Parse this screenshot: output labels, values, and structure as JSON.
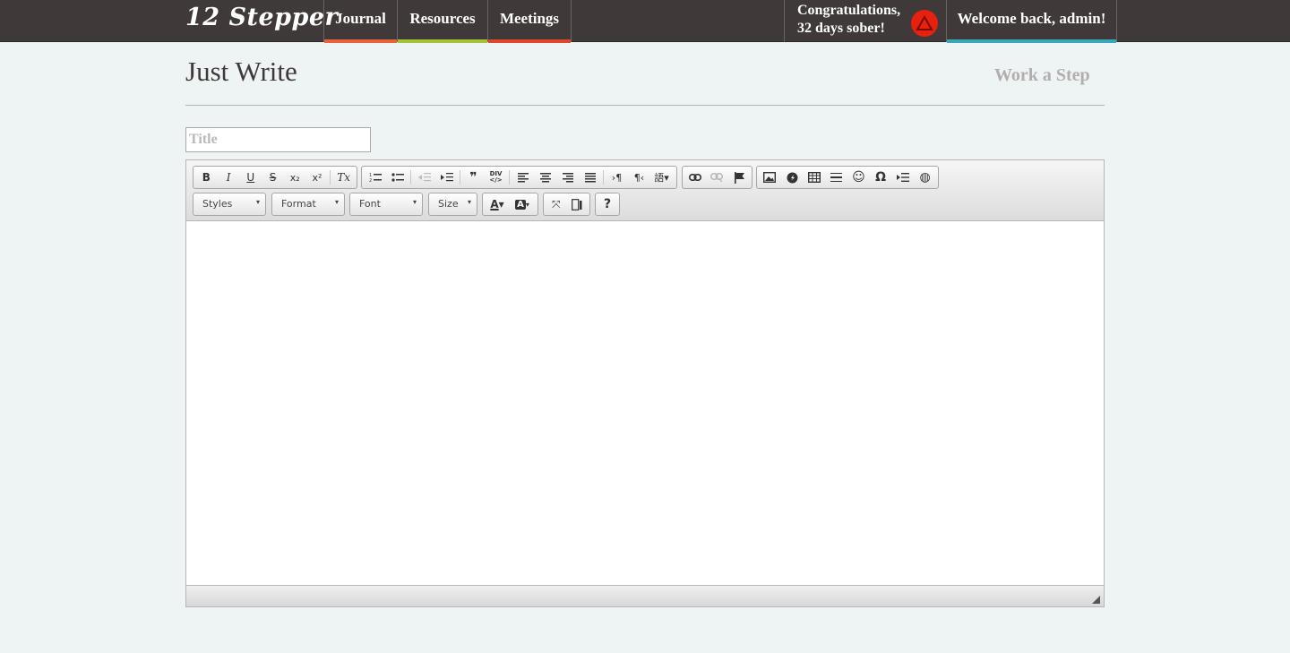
{
  "app": {
    "logo": "12 Stepper"
  },
  "nav": [
    {
      "label": "Journal",
      "color": "#e8623a"
    },
    {
      "label": "Resources",
      "color": "#a3c43a"
    },
    {
      "label": "Meetings",
      "color": "#e0452e"
    }
  ],
  "status": {
    "congrats_line1": "Congratulations,",
    "congrats_line2": "32 days sober!",
    "badge_icon": "recovery-triangle-icon"
  },
  "user": {
    "welcome": "Welcome back, admin!"
  },
  "page": {
    "title": "Just Write",
    "work_step_link": "Work a Step"
  },
  "form": {
    "title_placeholder": "Title"
  },
  "editor": {
    "format_buttons": [
      "B",
      "I",
      "U",
      "S",
      "x₂",
      "x²",
      "Tx"
    ],
    "combos": [
      "Styles",
      "Format",
      "Font",
      "Size"
    ]
  }
}
